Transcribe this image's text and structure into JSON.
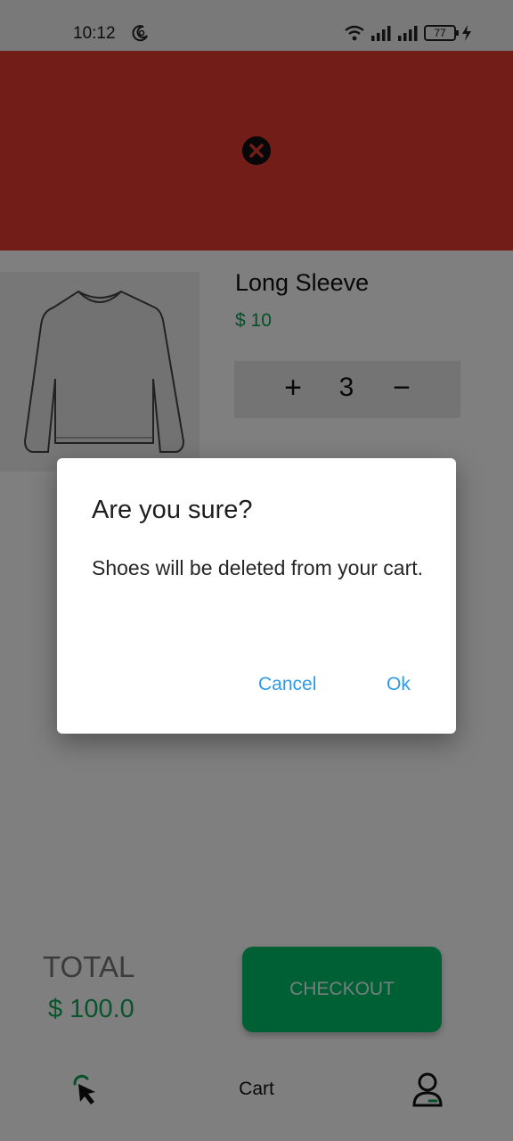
{
  "status_bar": {
    "time": "10:12",
    "battery": "77"
  },
  "cart_item": {
    "name": "Long Sleeve",
    "price": "$ 10",
    "quantity": "3",
    "increment_symbol": "+",
    "decrement_symbol": "−"
  },
  "summary": {
    "total_label": "TOTAL",
    "total_value": "$ 100.0",
    "checkout_label": "CHECKOUT"
  },
  "bottom_nav": {
    "cart_label": "Cart"
  },
  "dialog": {
    "title": "Are you sure?",
    "message": "Shoes will be deleted from your cart.",
    "cancel_label": "Cancel",
    "ok_label": "Ok"
  },
  "icons": {
    "moon": "moon-icon",
    "wifi": "wifi-icon",
    "signal": "signal-icon",
    "charging": "charging-icon",
    "delete": "close-circle-icon",
    "home": "cursor-icon",
    "profile": "user-icon"
  },
  "colors": {
    "banner": "#e53a2e",
    "price_green": "#0aa34f",
    "checkout_green": "#00c06a",
    "dialog_action": "#2e9be6"
  }
}
